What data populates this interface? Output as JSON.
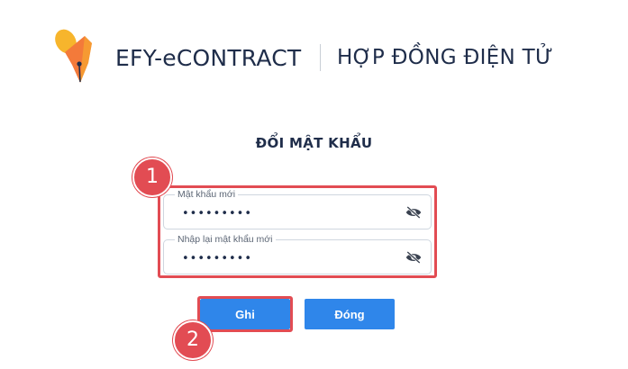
{
  "header": {
    "brand": "EFY-eCONTRACT",
    "subtitle": "HỢP ĐỒNG ĐIỆN TỬ",
    "logo_icon": "pen-nib-logo-icon"
  },
  "form": {
    "title": "ĐỔI MẬT KHẨU",
    "new_password": {
      "label": "Mật khẩu mới",
      "placeholder": "•••••••••",
      "icon": "eye-slash-icon"
    },
    "confirm_password": {
      "label": "Nhập lại mật khẩu mới",
      "placeholder": "•••••••••",
      "icon": "eye-slash-icon"
    }
  },
  "buttons": {
    "save_label": "Ghi",
    "close_label": "Đóng"
  },
  "annotations": {
    "step1": "1",
    "step2": "2"
  },
  "colors": {
    "primary": "#2f86ea",
    "annotation_red": "#e24c53",
    "text_dark": "#1f2d4a",
    "logo_yellow": "#f7b52c",
    "logo_orange": "#f37a3a"
  }
}
